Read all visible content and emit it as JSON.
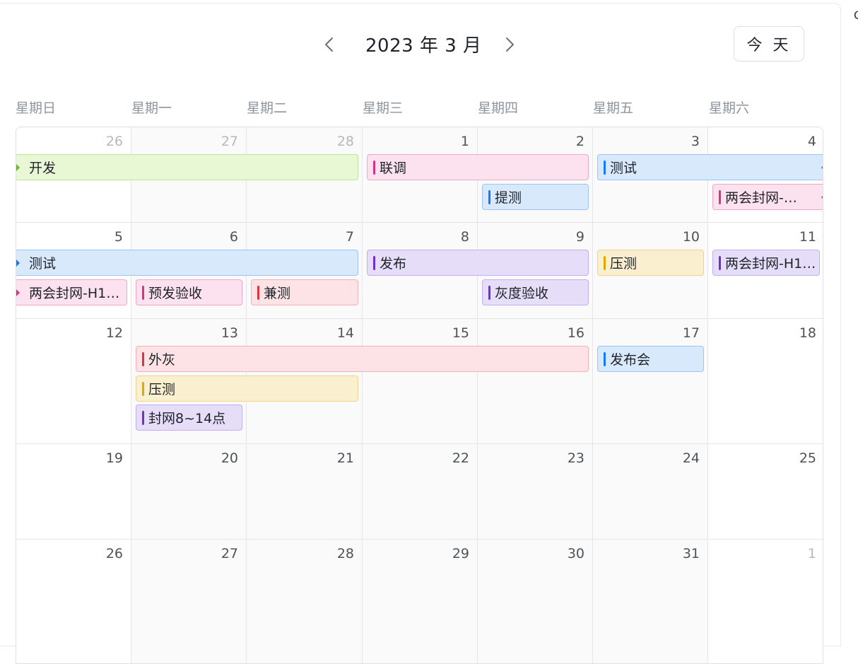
{
  "header": {
    "title": "2023 年 3 月",
    "today_label": "今 天",
    "edge_glyph": "Q"
  },
  "weekdays": [
    "星期日",
    "星期一",
    "星期二",
    "星期三",
    "星期四",
    "星期五",
    "星期六"
  ],
  "weeks": [
    [
      {
        "d": "26",
        "muted": true
      },
      {
        "d": "27",
        "muted": true
      },
      {
        "d": "28",
        "muted": true
      },
      {
        "d": "1"
      },
      {
        "d": "2"
      },
      {
        "d": "3"
      },
      {
        "d": "4"
      }
    ],
    [
      {
        "d": "5"
      },
      {
        "d": "6"
      },
      {
        "d": "7"
      },
      {
        "d": "8"
      },
      {
        "d": "9"
      },
      {
        "d": "10"
      },
      {
        "d": "11"
      }
    ],
    [
      {
        "d": "12"
      },
      {
        "d": "13"
      },
      {
        "d": "14"
      },
      {
        "d": "15"
      },
      {
        "d": "16"
      },
      {
        "d": "17"
      },
      {
        "d": "18"
      }
    ],
    [
      {
        "d": "19"
      },
      {
        "d": "20"
      },
      {
        "d": "21"
      },
      {
        "d": "22"
      },
      {
        "d": "23"
      },
      {
        "d": "24"
      },
      {
        "d": "25"
      }
    ],
    [
      {
        "d": "26"
      },
      {
        "d": "27"
      },
      {
        "d": "28"
      },
      {
        "d": "29"
      },
      {
        "d": "30"
      },
      {
        "d": "31"
      },
      {
        "d": "1",
        "muted": true
      }
    ]
  ],
  "colors": {
    "green": "#52c41a",
    "pink": "#d63384",
    "blue": "#1677ff",
    "purple": "#722ed1",
    "yellow": "#e0a800",
    "red": "#d9363e"
  },
  "events": [
    {
      "title": "开发",
      "color": "green",
      "week": 0,
      "start": 0,
      "end": 2,
      "row": 0,
      "cont_left": true
    },
    {
      "title": "联调",
      "color": "pink",
      "week": 0,
      "start": 3,
      "end": 4,
      "row": 0
    },
    {
      "title": "测试",
      "color": "blue",
      "week": 0,
      "start": 5,
      "end": 6,
      "row": 0,
      "cont_right": true
    },
    {
      "title": "提测",
      "color": "blue",
      "week": 0,
      "start": 4,
      "end": 4,
      "row": 1
    },
    {
      "title": "两会封网-…",
      "color": "pink",
      "week": 0,
      "start": 6,
      "end": 6,
      "row": 1,
      "cont_right": true
    },
    {
      "title": "测试",
      "color": "blue",
      "week": 1,
      "start": 0,
      "end": 2,
      "row": 0,
      "cont_left": true
    },
    {
      "title": "发布",
      "color": "purple",
      "week": 1,
      "start": 3,
      "end": 4,
      "row": 0
    },
    {
      "title": "压测",
      "color": "yellow",
      "week": 1,
      "start": 5,
      "end": 5,
      "row": 0
    },
    {
      "title": "两会封网-H1…",
      "color": "purple",
      "week": 1,
      "start": 6,
      "end": 6,
      "row": 0
    },
    {
      "title": "两会封网-H1…",
      "color": "pink",
      "week": 1,
      "start": 0,
      "end": 0,
      "row": 1,
      "cont_left": true
    },
    {
      "title": "预发验收",
      "color": "pink",
      "week": 1,
      "start": 1,
      "end": 1,
      "row": 1
    },
    {
      "title": "兼测",
      "color": "red",
      "week": 1,
      "start": 2,
      "end": 2,
      "row": 1
    },
    {
      "title": "灰度验收",
      "color": "purple",
      "week": 1,
      "start": 4,
      "end": 4,
      "row": 1
    },
    {
      "title": "外灰",
      "color": "red",
      "week": 2,
      "start": 1,
      "end": 4,
      "row": 0
    },
    {
      "title": "发布会",
      "color": "blue",
      "week": 2,
      "start": 5,
      "end": 5,
      "row": 0
    },
    {
      "title": "压测",
      "color": "yellow",
      "week": 2,
      "start": 1,
      "end": 2,
      "row": 1
    },
    {
      "title": "封网8~14点",
      "color": "purple",
      "week": 2,
      "start": 1,
      "end": 1,
      "row": 2
    }
  ]
}
